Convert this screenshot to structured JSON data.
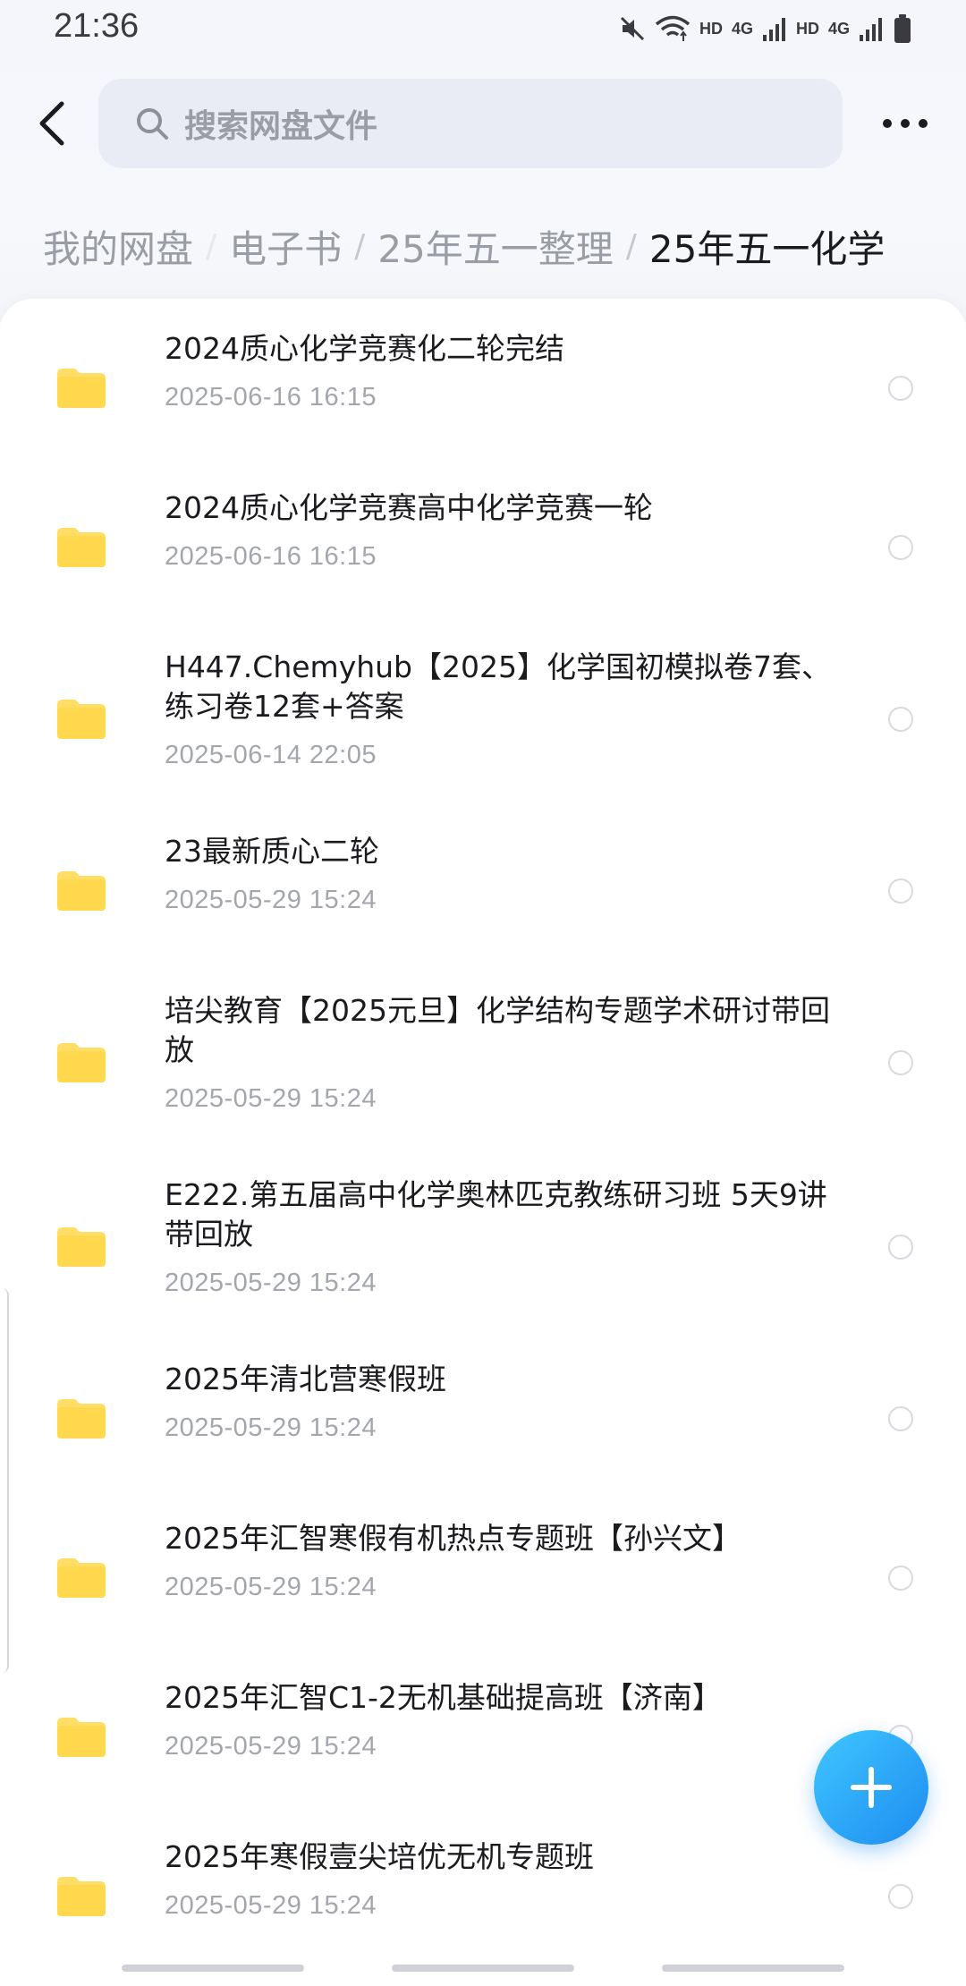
{
  "status_bar": {
    "time": "21:36",
    "hd_label_1": "HD",
    "net_label_1": "4G",
    "hd_label_2": "HD",
    "net_label_2": "4G"
  },
  "header": {
    "search_placeholder": "搜索网盘文件"
  },
  "breadcrumb": [
    "我的网盘",
    "电子书",
    "25年五一整理",
    "25年五一化学"
  ],
  "colors": {
    "folder": "#ffd84d",
    "accent": "#1d8cf0",
    "muted_text": "#a4a6ae"
  },
  "files": [
    {
      "title": "2024质心化学竞赛化二轮完结",
      "date": "2025-06-16  16:15",
      "icon": "folder-icon"
    },
    {
      "title": "2024质心化学竞赛高中化学竞赛一轮",
      "date": "2025-06-16  16:15",
      "icon": "folder-icon"
    },
    {
      "title": "H447.Chemyhub【2025】化学国初模拟卷7套、练习卷12套+答案",
      "date": "2025-06-14  22:05",
      "icon": "folder-icon"
    },
    {
      "title": "23最新质心二轮",
      "date": "2025-05-29  15:24",
      "icon": "folder-icon"
    },
    {
      "title": "培尖教育【2025元旦】化学结构专题学术研讨带回放",
      "date": "2025-05-29  15:24",
      "icon": "folder-icon"
    },
    {
      "title": "E222.第五届高中化学奥林匹克教练研习班 5天9讲带回放",
      "date": "2025-05-29  15:24",
      "icon": "folder-icon"
    },
    {
      "title": "2025年清北营寒假班",
      "date": "2025-05-29  15:24",
      "icon": "folder-icon"
    },
    {
      "title": "2025年汇智寒假有机热点专题班【孙兴文】",
      "date": "2025-05-29  15:24",
      "icon": "folder-icon"
    },
    {
      "title": "2025年汇智C1-2无机基础提高班【济南】",
      "date": "2025-05-29  15:24",
      "icon": "folder-icon"
    },
    {
      "title": "2025年寒假壹尖培优无机专题班",
      "date": "2025-05-29  15:24",
      "icon": "folder-icon"
    }
  ]
}
